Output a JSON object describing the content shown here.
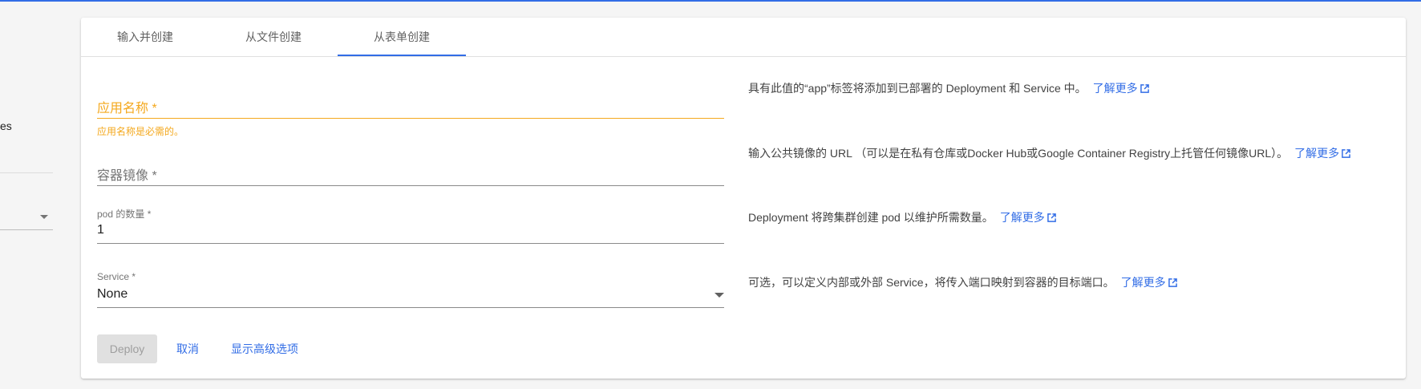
{
  "sidebar": {
    "clipped_text": "es"
  },
  "tabs": [
    {
      "label": "输入并创建"
    },
    {
      "label": "从文件创建"
    },
    {
      "label": "从表单创建"
    }
  ],
  "form": {
    "app_name": {
      "placeholder": "应用名称 *",
      "error": "应用名称是必需的。"
    },
    "image": {
      "placeholder": "容器镜像 *"
    },
    "pods": {
      "label": "pod 的数量 *",
      "value": "1"
    },
    "service": {
      "label": "Service *",
      "value": "None"
    }
  },
  "help": {
    "app_name": "具有此值的“app”标签将添加到已部署的 Deployment 和 Service 中。",
    "image": "输入公共镜像的 URL （可以是在私有仓库或Docker Hub或Google Container Registry上托管任何镜像URL）。",
    "pods": "Deployment 将跨集群创建 pod 以维护所需数量。",
    "service": "可选，可以定义内部或外部 Service，将传入端口映射到容器的目标端口。",
    "learn_more": "了解更多"
  },
  "actions": {
    "deploy": "Deploy",
    "cancel": "取消",
    "advanced": "显示高级选项"
  },
  "colors": {
    "primary": "#326de6",
    "warning": "#f4a81d",
    "disabled_bg": "#e0e0e0"
  }
}
